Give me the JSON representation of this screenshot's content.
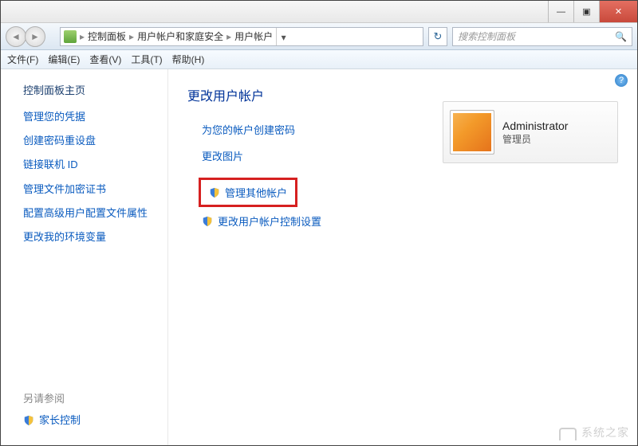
{
  "window": {
    "min": "—",
    "max": "▣",
    "close": "✕"
  },
  "breadcrumb": {
    "items": [
      "控制面板",
      "用户帐户和家庭安全",
      "用户帐户"
    ],
    "sep": "▸"
  },
  "search": {
    "placeholder": "搜索控制面板"
  },
  "menubar": {
    "file": "文件(F)",
    "edit": "编辑(E)",
    "view": "查看(V)",
    "tools": "工具(T)",
    "help": "帮助(H)"
  },
  "sidebar": {
    "header": "控制面板主页",
    "items": [
      "管理您的凭据",
      "创建密码重设盘",
      "链接联机 ID",
      "管理文件加密证书",
      "配置高级用户配置文件属性",
      "更改我的环境变量"
    ],
    "seealso_label": "另请参阅",
    "seealso_item": "家长控制"
  },
  "main": {
    "title": "更改用户帐户",
    "tasks": {
      "create_password": "为您的帐户创建密码",
      "change_picture": "更改图片",
      "manage_other": "管理其他帐户",
      "change_uac": "更改用户帐户控制设置"
    }
  },
  "user": {
    "name": "Administrator",
    "role": "管理员"
  },
  "watermark": "系统之家"
}
